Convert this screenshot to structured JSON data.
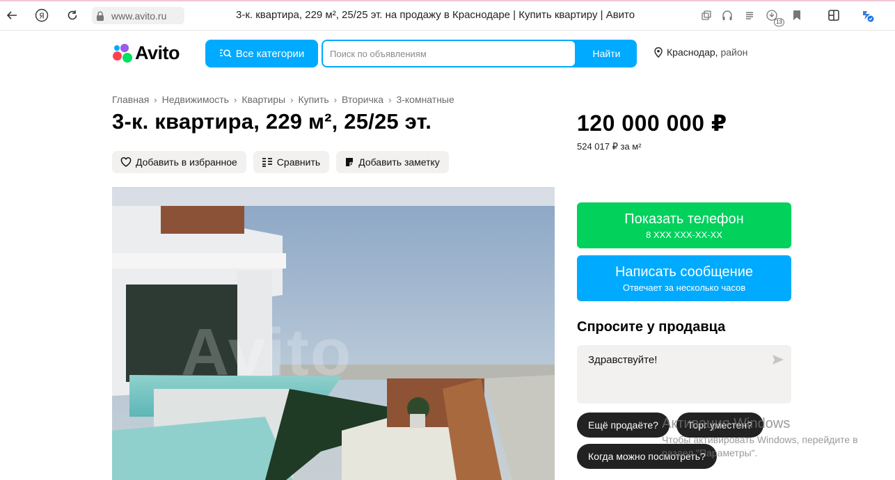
{
  "browser": {
    "url": "www.avito.ru",
    "tab_title": "3-к. квартира, 229 м², 25/25 эт. на продажу в Краснодаре | Купить квартиру | Авито",
    "badge_count": "13"
  },
  "header": {
    "logo_text": "Avito",
    "categories_label": "Все категории",
    "search_placeholder": "Поиск по объявлениям",
    "search_button": "Найти",
    "location_city": "Краснодар,",
    "location_suffix": "район"
  },
  "breadcrumb": [
    "Главная",
    "Недвижимость",
    "Квартиры",
    "Купить",
    "Вторичка",
    "3-комнатные"
  ],
  "listing": {
    "title": "3-к. квартира, 229 м², 25/25 эт.",
    "actions": {
      "favorite": "Добавить в избранное",
      "compare": "Сравнить",
      "note": "Добавить заметку"
    },
    "watermark": "Avito",
    "price": "120 000 000 ₽",
    "price_per_m2": "524 017 ₽ за м²"
  },
  "contact": {
    "phone_label": "Показать телефон",
    "phone_number": "8 XXX XXX-XX-XX",
    "message_label": "Написать сообщение",
    "message_sub": "Отвечает за несколько часов",
    "ask_title": "Спросите у продавца",
    "message_text": "Здравствуйте!",
    "quick_replies": [
      "Ещё продаёте?",
      "Торг уместен?",
      "Когда можно посмотреть?"
    ]
  },
  "os_overlay": {
    "line1": "Активация Windows",
    "line2": "Чтобы активировать Windows, перейдите в",
    "line3": "раздел \"Параметры\"."
  },
  "colors": {
    "accent_blue": "#00aaff",
    "accent_green": "#02d15c",
    "chip_dark": "#222222"
  }
}
